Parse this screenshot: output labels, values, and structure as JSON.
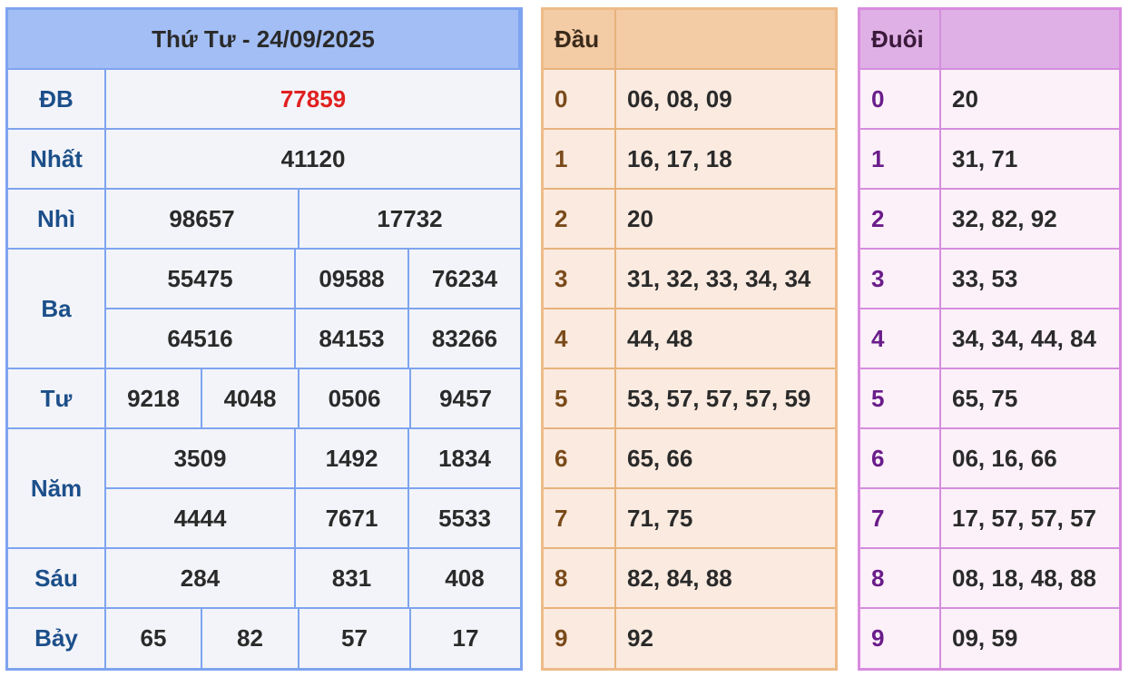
{
  "results": {
    "title": "Thứ Tư - 24/09/2025",
    "db": {
      "label": "ĐB",
      "value": "77859"
    },
    "nhat": {
      "label": "Nhất",
      "value": "41120"
    },
    "nhi": {
      "label": "Nhì",
      "values": [
        "98657",
        "17732"
      ]
    },
    "ba": {
      "label": "Ba",
      "values": [
        "55475",
        "09588",
        "76234",
        "64516",
        "84153",
        "83266"
      ]
    },
    "tu": {
      "label": "Tư",
      "values": [
        "9218",
        "4048",
        "0506",
        "9457"
      ]
    },
    "nam": {
      "label": "Năm",
      "values": [
        "3509",
        "1492",
        "1834",
        "4444",
        "7671",
        "5533"
      ]
    },
    "sau": {
      "label": "Sáu",
      "values": [
        "284",
        "831",
        "408"
      ]
    },
    "bay": {
      "label": "Bảy",
      "values": [
        "65",
        "82",
        "57",
        "17"
      ]
    }
  },
  "dau": {
    "header": "Đầu",
    "rows": [
      {
        "k": "0",
        "v": "06, 08, 09"
      },
      {
        "k": "1",
        "v": "16, 17, 18"
      },
      {
        "k": "2",
        "v": "20"
      },
      {
        "k": "3",
        "v": "31, 32, 33, 34, 34"
      },
      {
        "k": "4",
        "v": "44, 48"
      },
      {
        "k": "5",
        "v": "53, 57, 57, 57, 59"
      },
      {
        "k": "6",
        "v": "65, 66"
      },
      {
        "k": "7",
        "v": "71, 75"
      },
      {
        "k": "8",
        "v": "82, 84, 88"
      },
      {
        "k": "9",
        "v": "92"
      }
    ]
  },
  "duoi": {
    "header": "Đuôi",
    "rows": [
      {
        "k": "0",
        "v": "20"
      },
      {
        "k": "1",
        "v": "31, 71"
      },
      {
        "k": "2",
        "v": "32, 82, 92"
      },
      {
        "k": "3",
        "v": "33, 53"
      },
      {
        "k": "4",
        "v": "34, 34, 44, 84"
      },
      {
        "k": "5",
        "v": "65, 75"
      },
      {
        "k": "6",
        "v": "06, 16, 66"
      },
      {
        "k": "7",
        "v": "17, 57, 57, 57"
      },
      {
        "k": "8",
        "v": "08, 18, 48, 88"
      },
      {
        "k": "9",
        "v": "09, 59"
      }
    ]
  }
}
